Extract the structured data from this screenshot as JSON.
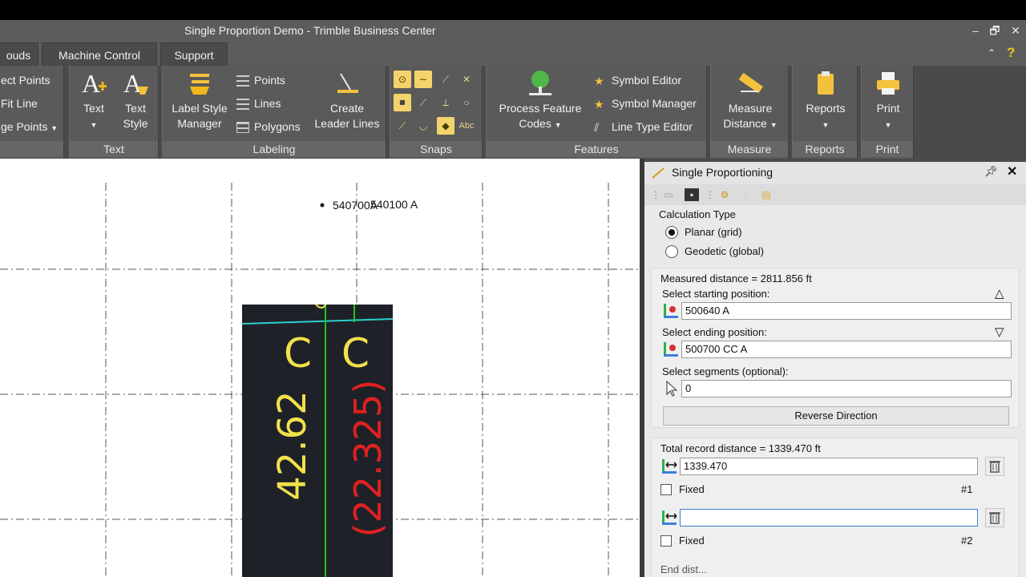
{
  "window": {
    "title": "Single Proportion Demo - Trimble Business Center",
    "controls": [
      "‒",
      "🗗",
      "✕"
    ]
  },
  "tabs": [
    "ouds",
    "Machine Control",
    "Support"
  ],
  "ribbon": {
    "partial_group": {
      "items": [
        "ect Points",
        "Fit Line",
        "ge Points"
      ]
    },
    "text_group": {
      "label": "Text",
      "text_button": "Text",
      "text_style_line1": "Text",
      "text_style_line2": "Style"
    },
    "labeling_group": {
      "label": "Labeling",
      "label_style_line1": "Label Style",
      "label_style_line2": "Manager",
      "points": "Points",
      "lines": "Lines",
      "polygons": "Polygons",
      "create_leader_line1": "Create",
      "create_leader_line2": "Leader Lines"
    },
    "snaps_group": {
      "label": "Snaps"
    },
    "features_group": {
      "label": "Features",
      "process_line1": "Process Feature",
      "process_line2": "Codes",
      "symbol_editor": "Symbol Editor",
      "symbol_manager": "Symbol Manager",
      "line_type_editor": "Line Type Editor"
    },
    "measure_group": {
      "label": "Measure",
      "measure_line1": "Measure",
      "measure_line2": "Distance"
    },
    "reports_group": {
      "label": "Reports",
      "reports_button": "Reports"
    },
    "print_group": {
      "label": "Print",
      "print_button": "Print"
    }
  },
  "canvas": {
    "point_label_a": "540700A",
    "point_label_b": "540100 A",
    "cad_c1": "C",
    "cad_c2": "C",
    "cad_value_yellow": "42.62",
    "cad_value_red": "(22.325)"
  },
  "panel": {
    "title": "Single Proportioning",
    "calc_type_label": "Calculation Type",
    "planar_label": "Planar (grid)",
    "geodetic_label": "Geodetic (global)",
    "calc_type_selected": "Planar (grid)",
    "measured_distance": "Measured distance = 2811.856 ft",
    "start_label": "Select starting position:",
    "start_value": "500640 A",
    "end_label": "Select ending position:",
    "end_value": "500700 CC A",
    "segments_label": "Select segments (optional):",
    "segments_value": "0",
    "reverse_button": "Reverse Direction",
    "total_record": "Total record distance = 1339.470 ft",
    "seg1_value": "1339.470",
    "seg1_fixed": "Fixed",
    "seg1_num": "#1",
    "seg2_value": "",
    "seg2_fixed": "Fixed",
    "seg2_num": "#2",
    "cut_off_label": "End dist..."
  },
  "colors": {
    "ribbon_bg": "#5a5a5a",
    "snap_active": "#f3d36b",
    "cad_yellow": "#f2e14a",
    "cad_red": "#e02020",
    "cad_green": "#22c322",
    "cad_cyan": "#2ad0d0",
    "focus_blue": "#3c7fd6"
  }
}
